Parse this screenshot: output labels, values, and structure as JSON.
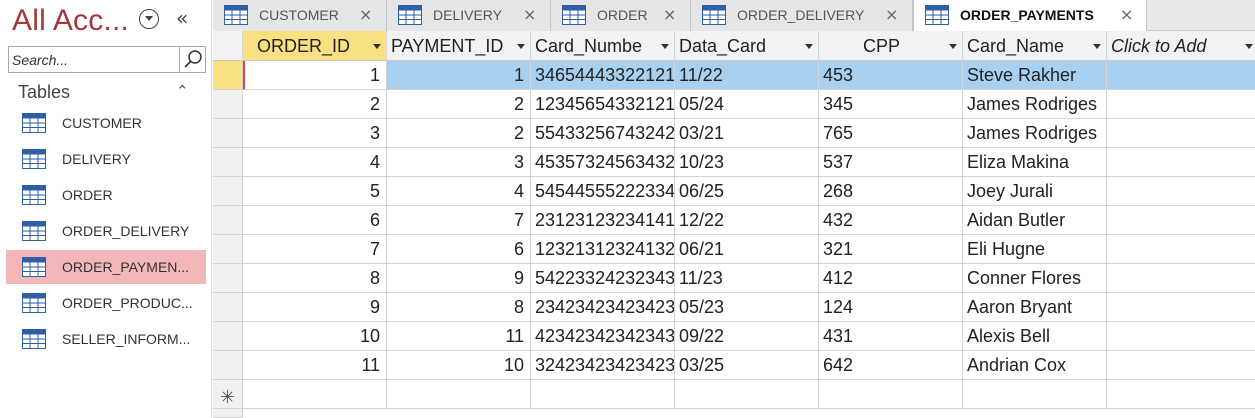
{
  "nav": {
    "title": "All Acc...",
    "collapse_glyph": "«",
    "search_placeholder": "Search...",
    "group_label": "Tables",
    "group_collapse_glyph": "⌃",
    "items": [
      {
        "label": "CUSTOMER",
        "icon": "table-icon"
      },
      {
        "label": "DELIVERY",
        "icon": "table-icon"
      },
      {
        "label": "ORDER",
        "icon": "table-icon"
      },
      {
        "label": "ORDER_DELIVERY",
        "icon": "table-icon"
      },
      {
        "label": "ORDER_PAYMEN...",
        "icon": "table-icon",
        "selected": true
      },
      {
        "label": "ORDER_PRODUC...",
        "icon": "table-icon"
      },
      {
        "label": "SELLER_INFORM...",
        "icon": "table-icon"
      }
    ]
  },
  "tabs": [
    {
      "label": "CUSTOMER",
      "close": "×"
    },
    {
      "label": "DELIVERY",
      "close": "×"
    },
    {
      "label": "ORDER",
      "close": "×"
    },
    {
      "label": "ORDER_DELIVERY",
      "close": "×"
    },
    {
      "label": "ORDER_PAYMENTS",
      "close": "×",
      "active": true
    }
  ],
  "datasheet": {
    "columns": [
      {
        "label": "ORDER_ID",
        "align": "right",
        "selected": true
      },
      {
        "label": "PAYMENT_ID",
        "align": "right"
      },
      {
        "label": "Card_Numbe",
        "align": "left"
      },
      {
        "label": "Data_Card",
        "align": "left"
      },
      {
        "label": "CPP",
        "align": "left"
      },
      {
        "label": "Card_Name",
        "align": "left"
      },
      {
        "label": "Click to Add",
        "align": "left",
        "italic": true
      }
    ],
    "rows": [
      [
        "1",
        "1",
        "34654443322121",
        "11/22",
        "453",
        "Steve Rakher",
        ""
      ],
      [
        "2",
        "2",
        "12345654332121",
        "05/24",
        "345",
        "James Rodriges",
        ""
      ],
      [
        "3",
        "2",
        "55433256743242",
        "03/21",
        "765",
        "James Rodriges",
        ""
      ],
      [
        "4",
        "3",
        "45357324563432",
        "10/23",
        "537",
        "Eliza Makina",
        ""
      ],
      [
        "5",
        "4",
        "54544555222334",
        "06/25",
        "268",
        "Joey Jurali",
        ""
      ],
      [
        "6",
        "7",
        "23123123234141",
        "12/22",
        "432",
        "Aidan Butler",
        ""
      ],
      [
        "7",
        "6",
        "12321312324132",
        "06/21",
        "321",
        "Eli Hugne",
        ""
      ],
      [
        "8",
        "9",
        "54223324232343",
        "11/23",
        "412",
        "Conner Flores",
        ""
      ],
      [
        "9",
        "8",
        "23423423423423",
        "05/23",
        "124",
        "Aaron Bryant",
        ""
      ],
      [
        "10",
        "11",
        "42342342342343",
        "09/22",
        "431",
        "Alexis Bell",
        ""
      ],
      [
        "11",
        "10",
        "32423423423423",
        "03/25",
        "642",
        "Andrian Cox",
        ""
      ]
    ],
    "selected_row": 0,
    "new_record_glyph": "✳"
  },
  "colors": {
    "nav_title": "#a4373a",
    "nav_selected": "#f3b7b9",
    "row_selected": "#a8d0f0",
    "column_selected_header": "#f9e080"
  }
}
